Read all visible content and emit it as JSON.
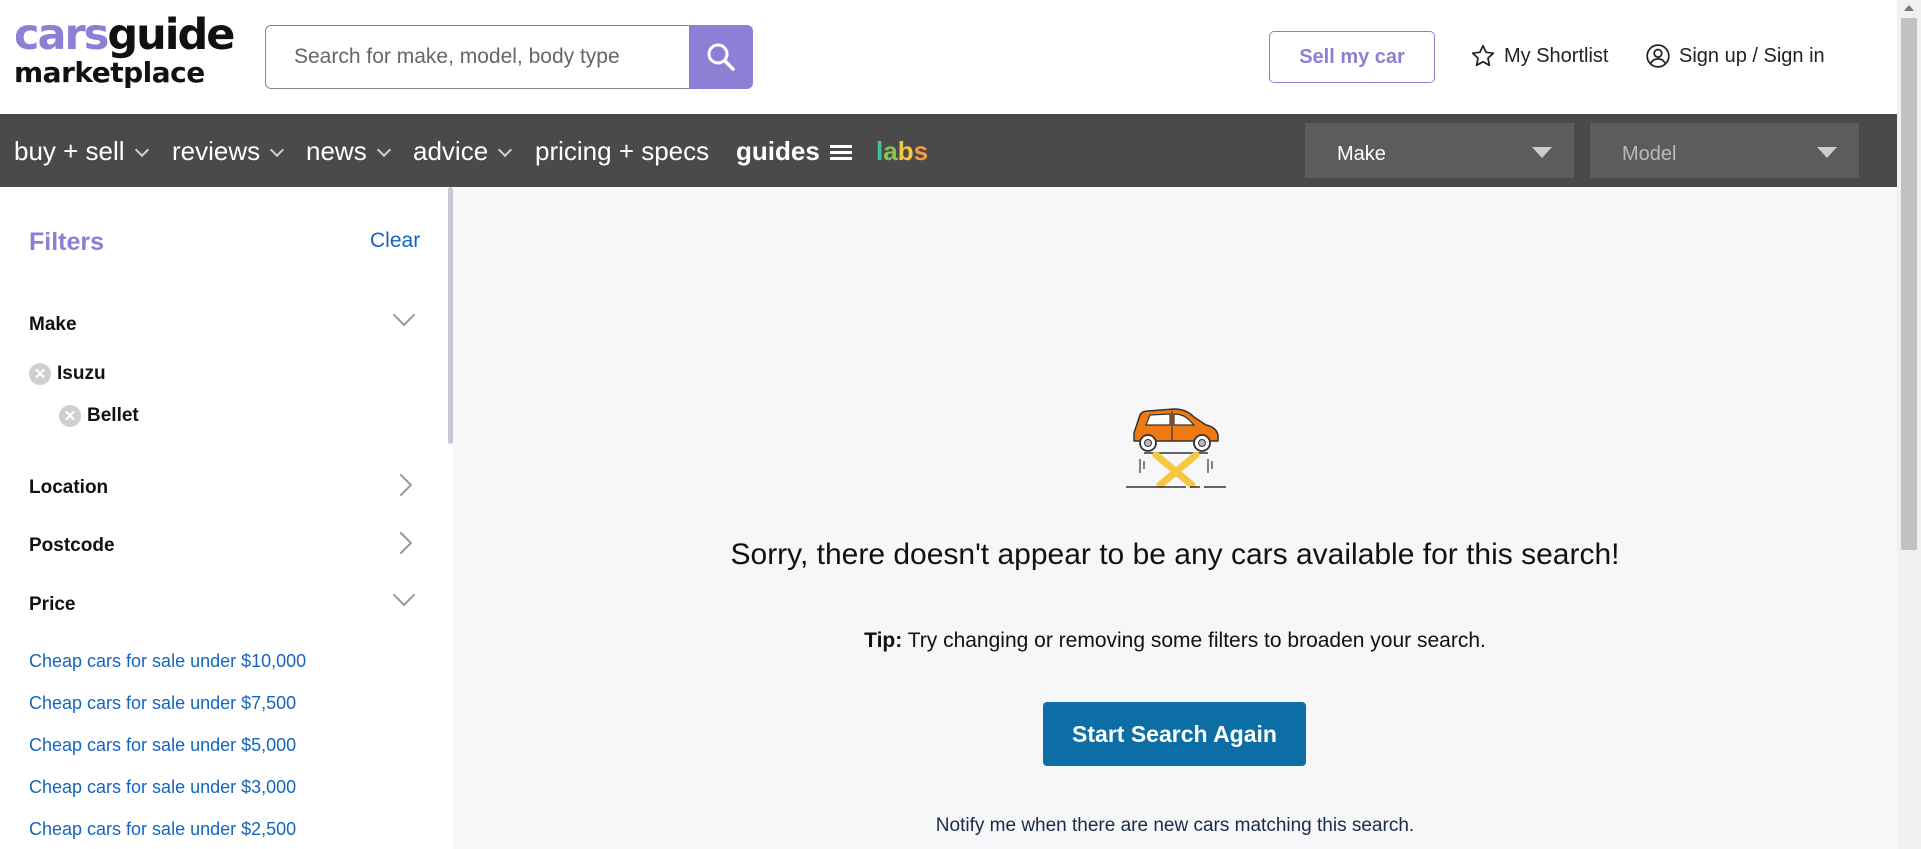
{
  "header": {
    "logo_line1_a": "cars",
    "logo_line1_b": "guide",
    "logo_line2": "marketplace",
    "search_placeholder": "Search for make, model, body type",
    "sell_label": "Sell my car",
    "shortlist_label": "My Shortlist",
    "signin_label": "Sign up / Sign in"
  },
  "nav": {
    "items": [
      "buy + sell",
      "reviews",
      "news",
      "advice",
      "pricing + specs"
    ],
    "guides_label": "guides",
    "labs_letters": [
      "l",
      "a",
      "b",
      "s"
    ],
    "make_select": "Make",
    "model_select": "Model"
  },
  "sidebar": {
    "title": "Filters",
    "clear": "Clear",
    "make_label": "Make",
    "make_chip": "Isuzu",
    "model_chip": "Bellet",
    "location_label": "Location",
    "postcode_label": "Postcode",
    "price_label": "Price",
    "price_links": [
      "Cheap cars for sale under $10,000",
      "Cheap cars for sale under $7,500",
      "Cheap cars for sale under $5,000",
      "Cheap cars for sale under $3,000",
      "Cheap cars for sale under $2,500"
    ]
  },
  "main": {
    "sorry": "Sorry, there doesn't appear to be any cars available for this search!",
    "tip_bold": "Tip:",
    "tip_text": " Try changing or removing some filters to broaden your search.",
    "start_button": "Start Search Again",
    "notify": "Notify me when there are new cars matching this search."
  },
  "colors": {
    "brand_purple": "#8e7fd6",
    "nav_bg": "#4a4a4a",
    "link_blue": "#1565c0",
    "cta_blue": "#0d6ea6",
    "car_orange": "#f07a12",
    "lift_yellow": "#f5c842"
  }
}
